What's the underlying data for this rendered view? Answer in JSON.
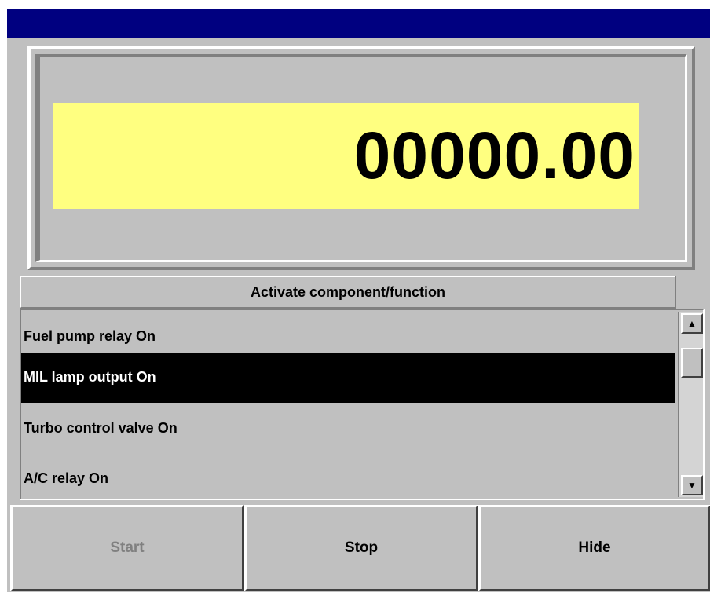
{
  "readout": {
    "value": "00000.00"
  },
  "list": {
    "header": "Activate component/function",
    "items": [
      {
        "label": "Fuel pump relay On"
      },
      {
        "label": "MIL lamp output On"
      },
      {
        "label": "Turbo control valve On"
      },
      {
        "label": "A/C relay On"
      }
    ],
    "selected_index": 1
  },
  "buttons": {
    "start_label": "Start",
    "stop_label": "Stop",
    "hide_label": "Hide"
  },
  "colors": {
    "titlebar": "#000080",
    "readout_background": "#ffff80",
    "selection": "#000000"
  },
  "icons": {
    "scroll_up": "scroll-up-arrow-icon",
    "scroll_down": "scroll-down-arrow-icon"
  }
}
